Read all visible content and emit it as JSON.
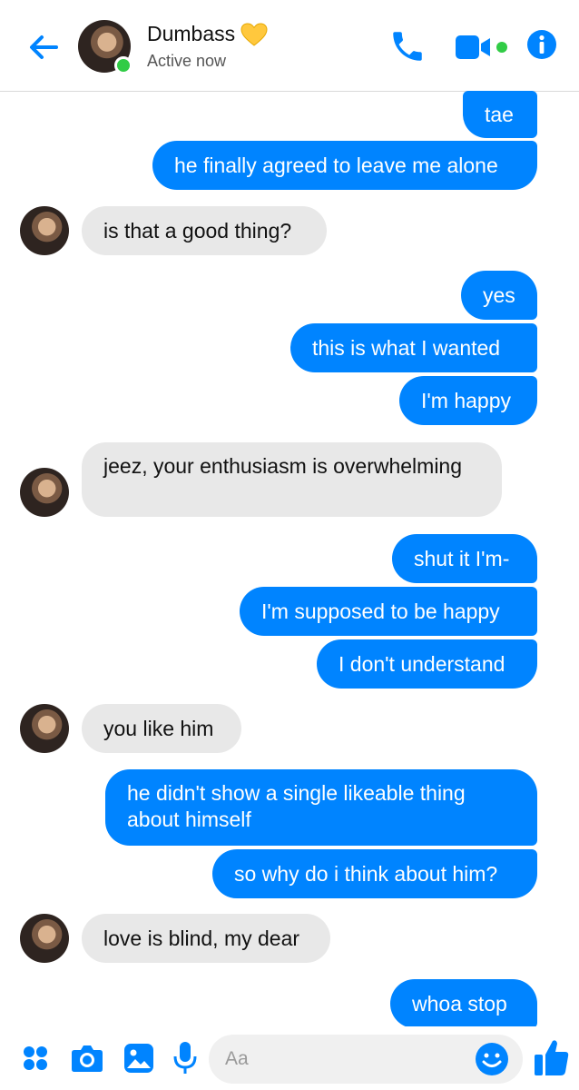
{
  "header": {
    "contact_name": "Dumbass",
    "status": "Active now",
    "accent": "#0084ff",
    "icons": [
      "back-arrow-icon",
      "phone-icon",
      "video-camera-icon",
      "info-icon",
      "yellow-heart-icon"
    ]
  },
  "messages": [
    {
      "from": "me",
      "text": "tae"
    },
    {
      "from": "me",
      "text": "he finally agreed to leave me alone"
    },
    {
      "from": "them",
      "text": "is that a good thing?"
    },
    {
      "from": "me",
      "text": "yes"
    },
    {
      "from": "me",
      "text": "this is what I wanted"
    },
    {
      "from": "me",
      "text": "I'm happy"
    },
    {
      "from": "them",
      "text": "jeez, your enthusiasm is overwhelming"
    },
    {
      "from": "me",
      "text": "shut it I'm-"
    },
    {
      "from": "me",
      "text": "I'm supposed to be happy"
    },
    {
      "from": "me",
      "text": "I don't understand"
    },
    {
      "from": "them",
      "text": "you like him"
    },
    {
      "from": "me",
      "text": "he didn't show a single likeable thing about himself"
    },
    {
      "from": "me",
      "text": "so why do i think about him?"
    },
    {
      "from": "them",
      "text": "love is blind, my dear"
    },
    {
      "from": "me",
      "text": "whoa stop"
    }
  ],
  "composer": {
    "placeholder": "Aa",
    "icons": [
      "apps-icon",
      "camera-icon",
      "gallery-icon",
      "microphone-icon",
      "emoji-icon",
      "thumbs-up-icon"
    ]
  }
}
